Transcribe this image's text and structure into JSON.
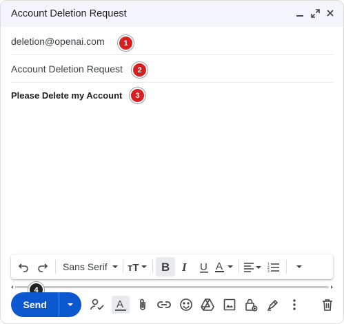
{
  "window": {
    "title": "Account Deletion Request"
  },
  "compose": {
    "to": "deletion@openai.com",
    "subject": "Account Deletion Request",
    "body": "Please Delete my Account"
  },
  "badges": [
    "1",
    "2",
    "3",
    "4"
  ],
  "formatting": {
    "font": "Sans Serif",
    "tools": [
      "undo-icon",
      "redo-icon",
      "font-selector",
      "text-size-icon",
      "bold-icon",
      "italic-icon",
      "underline-icon",
      "text-color-icon",
      "align-icon",
      "numbered-list-icon",
      "more-formatting-icon"
    ]
  },
  "send": {
    "label": "Send"
  },
  "bottom_tools": [
    "insert-contact-icon",
    "formatting-options-icon",
    "attach-icon",
    "link-icon",
    "emoji-icon",
    "drive-icon",
    "image-icon",
    "confidential-icon",
    "signature-icon",
    "more-options-icon",
    "trash-icon"
  ],
  "colors": {
    "accent": "#0b57d0",
    "titlebar": "#f2f6fc",
    "badge": "#d61f1f"
  }
}
